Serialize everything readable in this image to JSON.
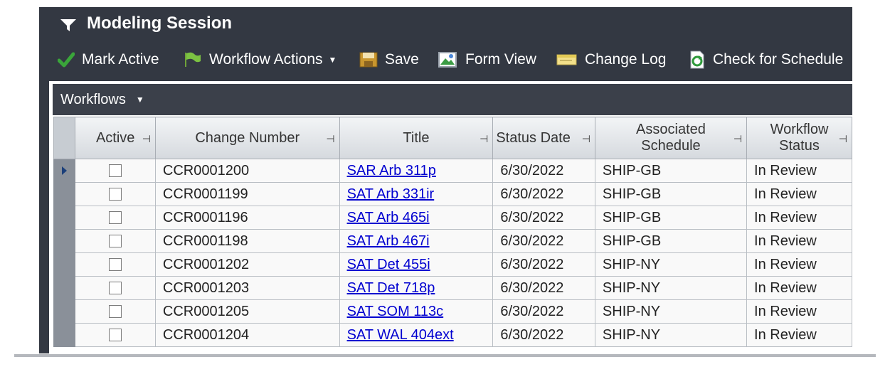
{
  "session": {
    "title": "Modeling Session"
  },
  "toolbar": {
    "mark_active": "Mark Active",
    "workflow_actions": "Workflow Actions",
    "save": "Save",
    "form_view": "Form View",
    "change_log": "Change Log",
    "check_for_schedule": "Check for Schedule"
  },
  "grid": {
    "dropdown_label": "Workflows",
    "columns": {
      "active": "Active",
      "change_number": "Change Number",
      "title": "Title",
      "status_date": "Status Date",
      "associated_schedule": "Associated Schedule",
      "workflow_status": "Workflow Status"
    },
    "rows": [
      {
        "change_number": "CCR0001200",
        "title": "SAR Arb 311p",
        "status_date": "6/30/2022",
        "schedule": "SHIP-GB",
        "status": "In Review"
      },
      {
        "change_number": "CCR0001199",
        "title": "SAT Arb 331ir",
        "status_date": "6/30/2022",
        "schedule": "SHIP-GB",
        "status": "In Review"
      },
      {
        "change_number": "CCR0001196",
        "title": "SAT Arb 465i",
        "status_date": "6/30/2022",
        "schedule": "SHIP-GB",
        "status": "In Review"
      },
      {
        "change_number": "CCR0001198",
        "title": "SAT Arb 467i",
        "status_date": "6/30/2022",
        "schedule": "SHIP-GB",
        "status": "In Review"
      },
      {
        "change_number": "CCR0001202",
        "title": "SAT Det 455i",
        "status_date": "6/30/2022",
        "schedule": "SHIP-NY",
        "status": "In Review"
      },
      {
        "change_number": "CCR0001203",
        "title": "SAT Det 718p",
        "status_date": "6/30/2022",
        "schedule": "SHIP-NY",
        "status": "In Review"
      },
      {
        "change_number": "CCR0001205",
        "title": "SAT SOM 113c",
        "status_date": "6/30/2022",
        "schedule": "SHIP-NY",
        "status": "In Review"
      },
      {
        "change_number": "CCR0001204",
        "title": "SAT WAL 404ext",
        "status_date": "6/30/2022",
        "schedule": "SHIP-NY",
        "status": "In Review"
      }
    ]
  },
  "icons": {
    "session": "funnel-icon",
    "mark_active": "checkmark-icon",
    "workflow_actions": "flag-icon",
    "save": "save-icon",
    "form_view": "form-view-icon",
    "change_log": "change-log-icon",
    "check_for_schedule": "refresh-icon",
    "column_pin": "pin-icon",
    "row_selector": "row-indicator-icon"
  },
  "colors": {
    "panel_background": "#333842",
    "link": "#0000d0",
    "check_green": "#3aa53a"
  }
}
